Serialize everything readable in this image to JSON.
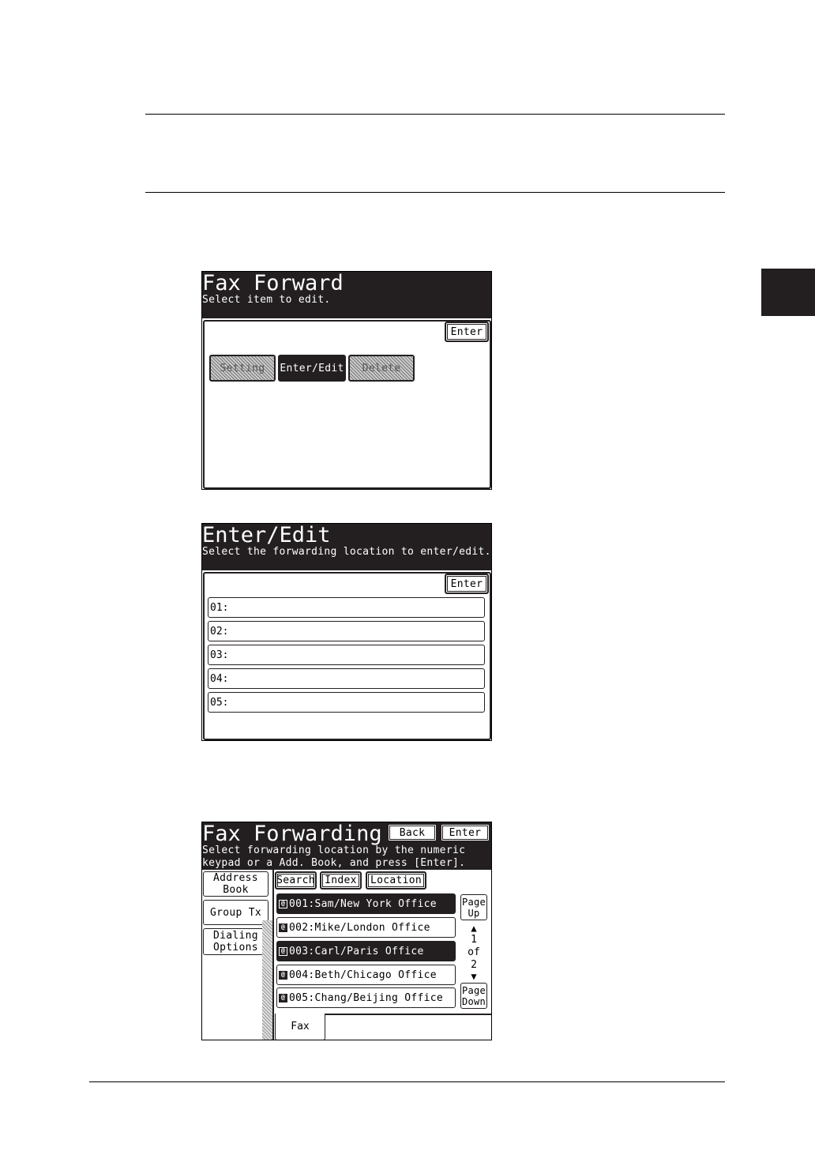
{
  "screen1": {
    "title": "Fax Forward",
    "subtitle": "Select item to edit.",
    "enter_label": "Enter",
    "buttons": [
      "Setting",
      "Enter/Edit",
      "Delete"
    ]
  },
  "screen2": {
    "title": "Enter/Edit",
    "subtitle": "Select the forwarding location to enter/edit.",
    "enter_label": "Enter",
    "entries": [
      "01:",
      "02:",
      "03:",
      "04:",
      "05:"
    ]
  },
  "screen3": {
    "title": "Fax Forwarding",
    "back_label": "Back",
    "enter_label": "Enter",
    "subtitle_line1": "Select forwarding location by the numeric",
    "subtitle_line2": "keypad or a Add. Book, and press [Enter].",
    "side_buttons": {
      "address_book": [
        "Address",
        "Book"
      ],
      "group_tx": "Group Tx",
      "dialing_options": [
        "Dialing",
        "Options"
      ]
    },
    "tabs": [
      "Search",
      "Index",
      "Location"
    ],
    "list": [
      {
        "text": "001:Sam/New York Office",
        "selected": true
      },
      {
        "text": "002:Mike/London Office",
        "selected": false
      },
      {
        "text": "003:Carl/Paris Office",
        "selected": true
      },
      {
        "text": "004:Beth/Chicago Office",
        "selected": false
      },
      {
        "text": "005:Chang/Beijing Office",
        "selected": false
      }
    ],
    "icon_glyph": "@",
    "page_up": [
      "Page",
      "Up"
    ],
    "page_down": [
      "Page",
      "Down"
    ],
    "page_current": "1",
    "page_of": "of",
    "page_total": "2",
    "bottom_tab": "Fax"
  }
}
